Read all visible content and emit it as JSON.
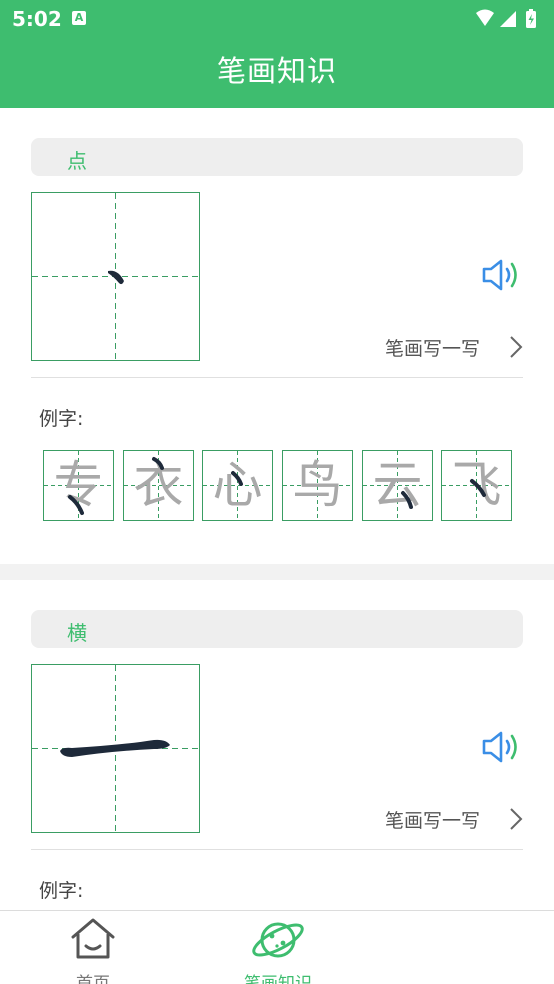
{
  "status_bar": {
    "time": "5:02",
    "notification_badge": "A"
  },
  "header": {
    "title": "笔画知识"
  },
  "strokes": [
    {
      "name": "点",
      "practice_label": "笔画写一写",
      "example_label": "例字:",
      "examples": [
        "专",
        "衣",
        "心",
        "鸟",
        "云",
        "飞"
      ]
    },
    {
      "name": "横",
      "practice_label": "笔画写一写",
      "example_label": "例字:"
    }
  ],
  "bottom_nav": {
    "items": [
      {
        "label": "首页",
        "icon": "home-icon",
        "active": false
      },
      {
        "label": "笔画知识",
        "icon": "planet-icon",
        "active": true
      }
    ]
  },
  "colors": {
    "brand_green": "#3ebd6f",
    "speaker_blue": "#3a8ee6",
    "grid_green": "#3a9d63",
    "stroke_dark": "#1e2a3a"
  }
}
